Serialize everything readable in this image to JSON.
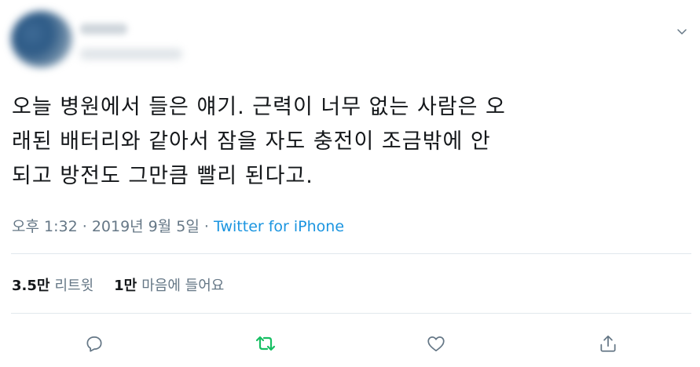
{
  "tweet": {
    "text_lines": [
      "오늘 병원에서 들은 얘기. 근력이 너무 없는 사람은 오",
      "래된 배터리와 같아서 잠을 자도 충전이 조금밖에 안",
      "되고 방전도 그만큼 빨리 된다고."
    ],
    "time": "오후 1:32",
    "separator": "·",
    "date": "2019년 9월 5일",
    "source": "Twitter for iPhone"
  },
  "stats": {
    "retweets_count": "3.5만",
    "retweets_label": "리트윗",
    "likes_count": "1만",
    "likes_label": "마음에 들어요"
  },
  "icons": {
    "reply": "reply-icon",
    "retweet": "retweet-icon",
    "like": "heart-icon",
    "share": "share-icon",
    "menu": "chevron-down-icon"
  },
  "colors": {
    "text": "#14171a",
    "secondary": "#657786",
    "link": "#1b95e0",
    "retweet_green": "#17bf63",
    "divider": "#e1e8ed"
  }
}
